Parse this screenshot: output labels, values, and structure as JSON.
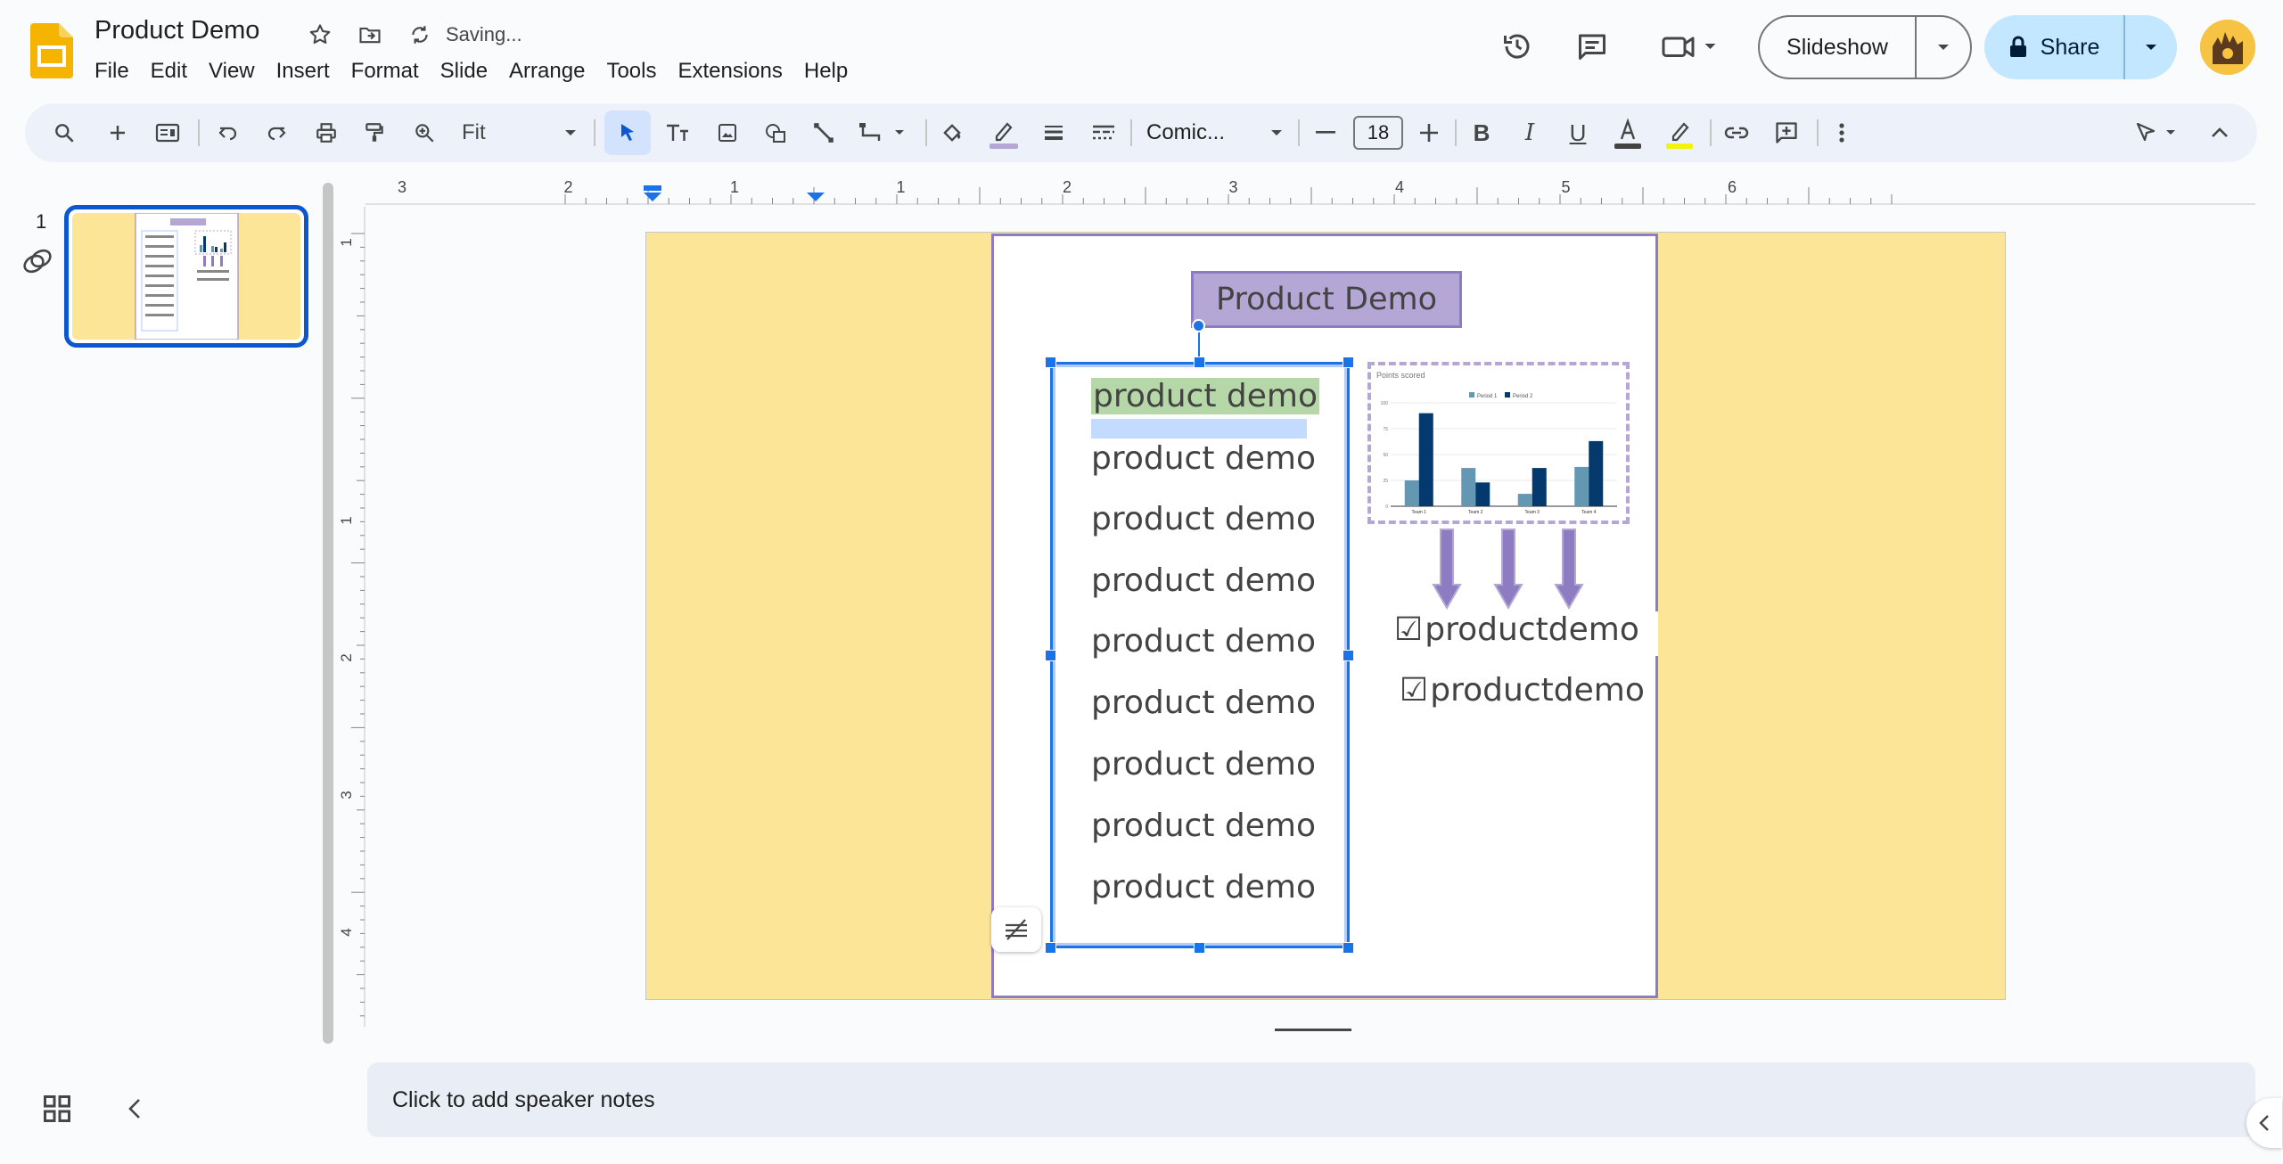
{
  "header": {
    "doc_title": "Product Demo",
    "status": "Saving...",
    "menu": [
      "File",
      "Edit",
      "View",
      "Insert",
      "Format",
      "Slide",
      "Arrange",
      "Tools",
      "Extensions",
      "Help"
    ],
    "slideshow_label": "Slideshow",
    "share_label": "Share"
  },
  "toolbar": {
    "zoom": "Fit",
    "font": "Comic...",
    "font_size": "18"
  },
  "filmstrip": {
    "slide_number": "1"
  },
  "ruler": {
    "h_ticks": [
      "3",
      "2",
      "1",
      "1",
      "2",
      "3",
      "4",
      "5",
      "6"
    ],
    "v_ticks": [
      "1",
      "1",
      "2",
      "3",
      "4"
    ]
  },
  "slide": {
    "title": "Product Demo",
    "lines": [
      "product demo",
      "product demo",
      "product demo",
      "product demo",
      "product demo",
      "product demo",
      "product demo",
      "product demo",
      "product demo"
    ],
    "checklist": [
      "productdemo",
      "productdemo"
    ],
    "check_symbol": "☑"
  },
  "chart_data": {
    "type": "bar",
    "title": "Points scored",
    "categories": [
      "Team 1",
      "Team 2",
      "Team 3",
      "Team 4"
    ],
    "series": [
      {
        "name": "Period 1",
        "values": [
          25,
          37,
          12,
          38
        ],
        "color": "#6497b1"
      },
      {
        "name": "Period 2",
        "values": [
          90,
          23,
          37,
          63
        ],
        "color": "#03396c"
      }
    ],
    "ylim": [
      0,
      100
    ],
    "y_ticks": [
      "0",
      "25",
      "50",
      "75",
      "100"
    ],
    "legend": "top"
  },
  "notes": {
    "placeholder": "Click to add speaker notes"
  },
  "colors": {
    "slide_bg": "#fde598",
    "title_fill": "#b4a7d6",
    "accent": "#8e7cc3",
    "selection": "#1a73e8",
    "highlight": "#b6d7a8"
  }
}
